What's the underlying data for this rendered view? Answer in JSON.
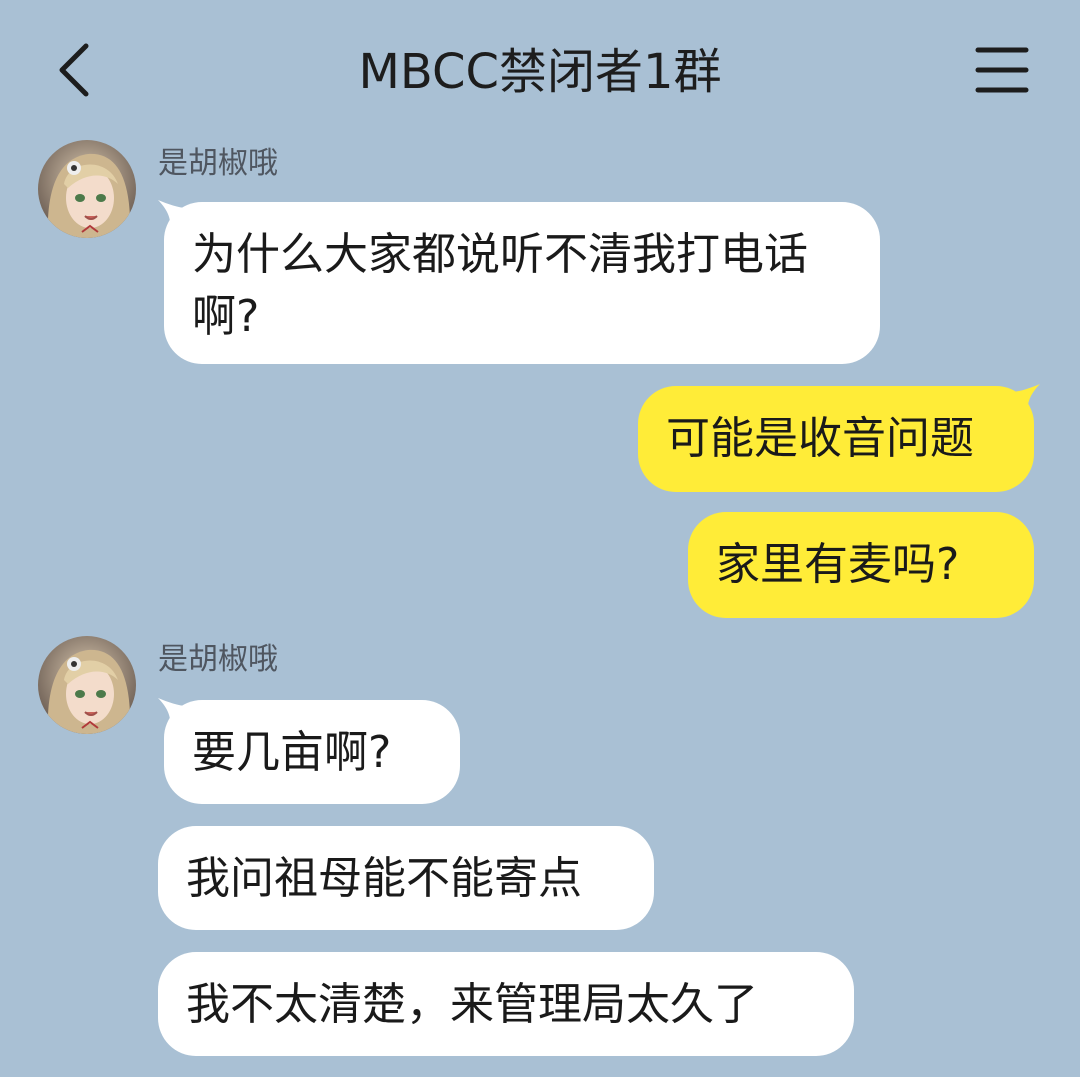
{
  "header": {
    "title": "MBCC禁闭者1群",
    "back_icon": "chevron-left-icon",
    "menu_icon": "hamburger-menu-icon"
  },
  "colors": {
    "background": "#a9c0d4",
    "incoming_bubble": "#ffffff",
    "outgoing_bubble": "#ffec38"
  },
  "messages": [
    {
      "sender": "是胡椒哦",
      "direction": "in",
      "text": "为什么大家都说听不清我打电话啊?"
    },
    {
      "direction": "out",
      "text": "可能是收音问题"
    },
    {
      "direction": "out",
      "text": "家里有麦吗?"
    },
    {
      "sender": "是胡椒哦",
      "direction": "in",
      "text": "要几亩啊?"
    },
    {
      "direction": "in",
      "text": "我问祖母能不能寄点"
    },
    {
      "direction": "in",
      "text": "我不太清楚，来管理局太久了"
    }
  ]
}
